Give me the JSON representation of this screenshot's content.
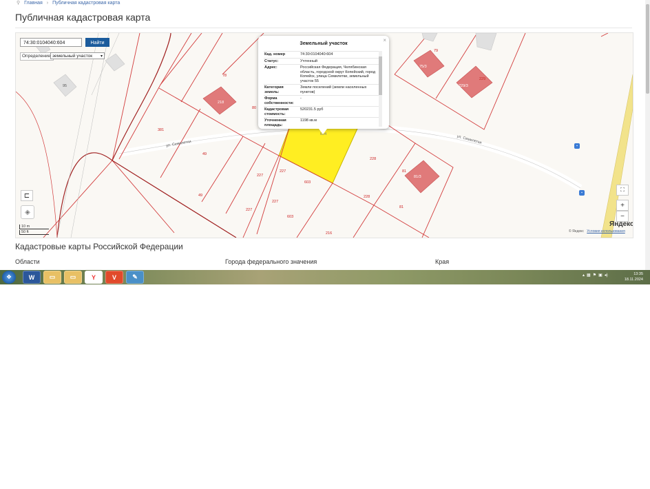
{
  "breadcrumb": {
    "home": "Главная",
    "current": "Публичная кадастровая карта"
  },
  "page_title": "Публичная кадастровая карта",
  "search": {
    "value": "74:30:0104040:604",
    "button": "Найти",
    "mode_label": "Определение:",
    "mode_value": "земельный участок"
  },
  "popup": {
    "title": "Земельный участок",
    "close": "×",
    "rows": [
      {
        "k": "Кад. номер",
        "v": "74:30:0104040:604"
      },
      {
        "k": "Статус:",
        "v": "Учтенный"
      },
      {
        "k": "Адрес:",
        "v": "Российская Федерация, Челябинская область, городской округ Копейский, город Копейск, улица Семилетки, земельный участок 55"
      },
      {
        "k": "Категория земель:",
        "v": "Земли поселений (земли населенных пунктов)"
      },
      {
        "k": "Форма собственности:",
        "v": "-"
      },
      {
        "k": "Кадастровая стоимость:",
        "v": "520231.5 руб"
      },
      {
        "k": "Уточненная площадь:",
        "v": "1198 кв.м"
      }
    ]
  },
  "map": {
    "parcel_labels": [
      "78",
      "80",
      "95",
      "381",
      "49",
      "49",
      "227",
      "227",
      "227",
      "227",
      "603",
      "603",
      "604",
      "228",
      "228",
      "81",
      "81",
      "216",
      "79",
      "229"
    ],
    "building_labels": [
      "218",
      "229/3",
      "229/2",
      "75/3",
      "81/3"
    ],
    "street_labels": [
      "ул. Семилетки",
      "ул. Семилетки"
    ],
    "scale": [
      "10 m",
      "50 ft"
    ],
    "logo": "Яндекс",
    "attribution": "© Яндекс",
    "terms_link": "Условия использования",
    "colors": {
      "boundary": "#d23b3b",
      "selected_parcel": "#ffee22",
      "building": "#e07a7a",
      "road": "#f2e38b"
    }
  },
  "section_title": "Кадастровые карты Российской Федерации",
  "columns": [
    "Области",
    "Города федерального значения",
    "Края"
  ],
  "taskbar": {
    "apps": [
      "word-icon",
      "folder-icon",
      "folder-icon",
      "yandex-browser-icon",
      "vivaldi-icon",
      "pen-icon"
    ],
    "clock_time": "13:35",
    "clock_date": "18.11.2024"
  }
}
